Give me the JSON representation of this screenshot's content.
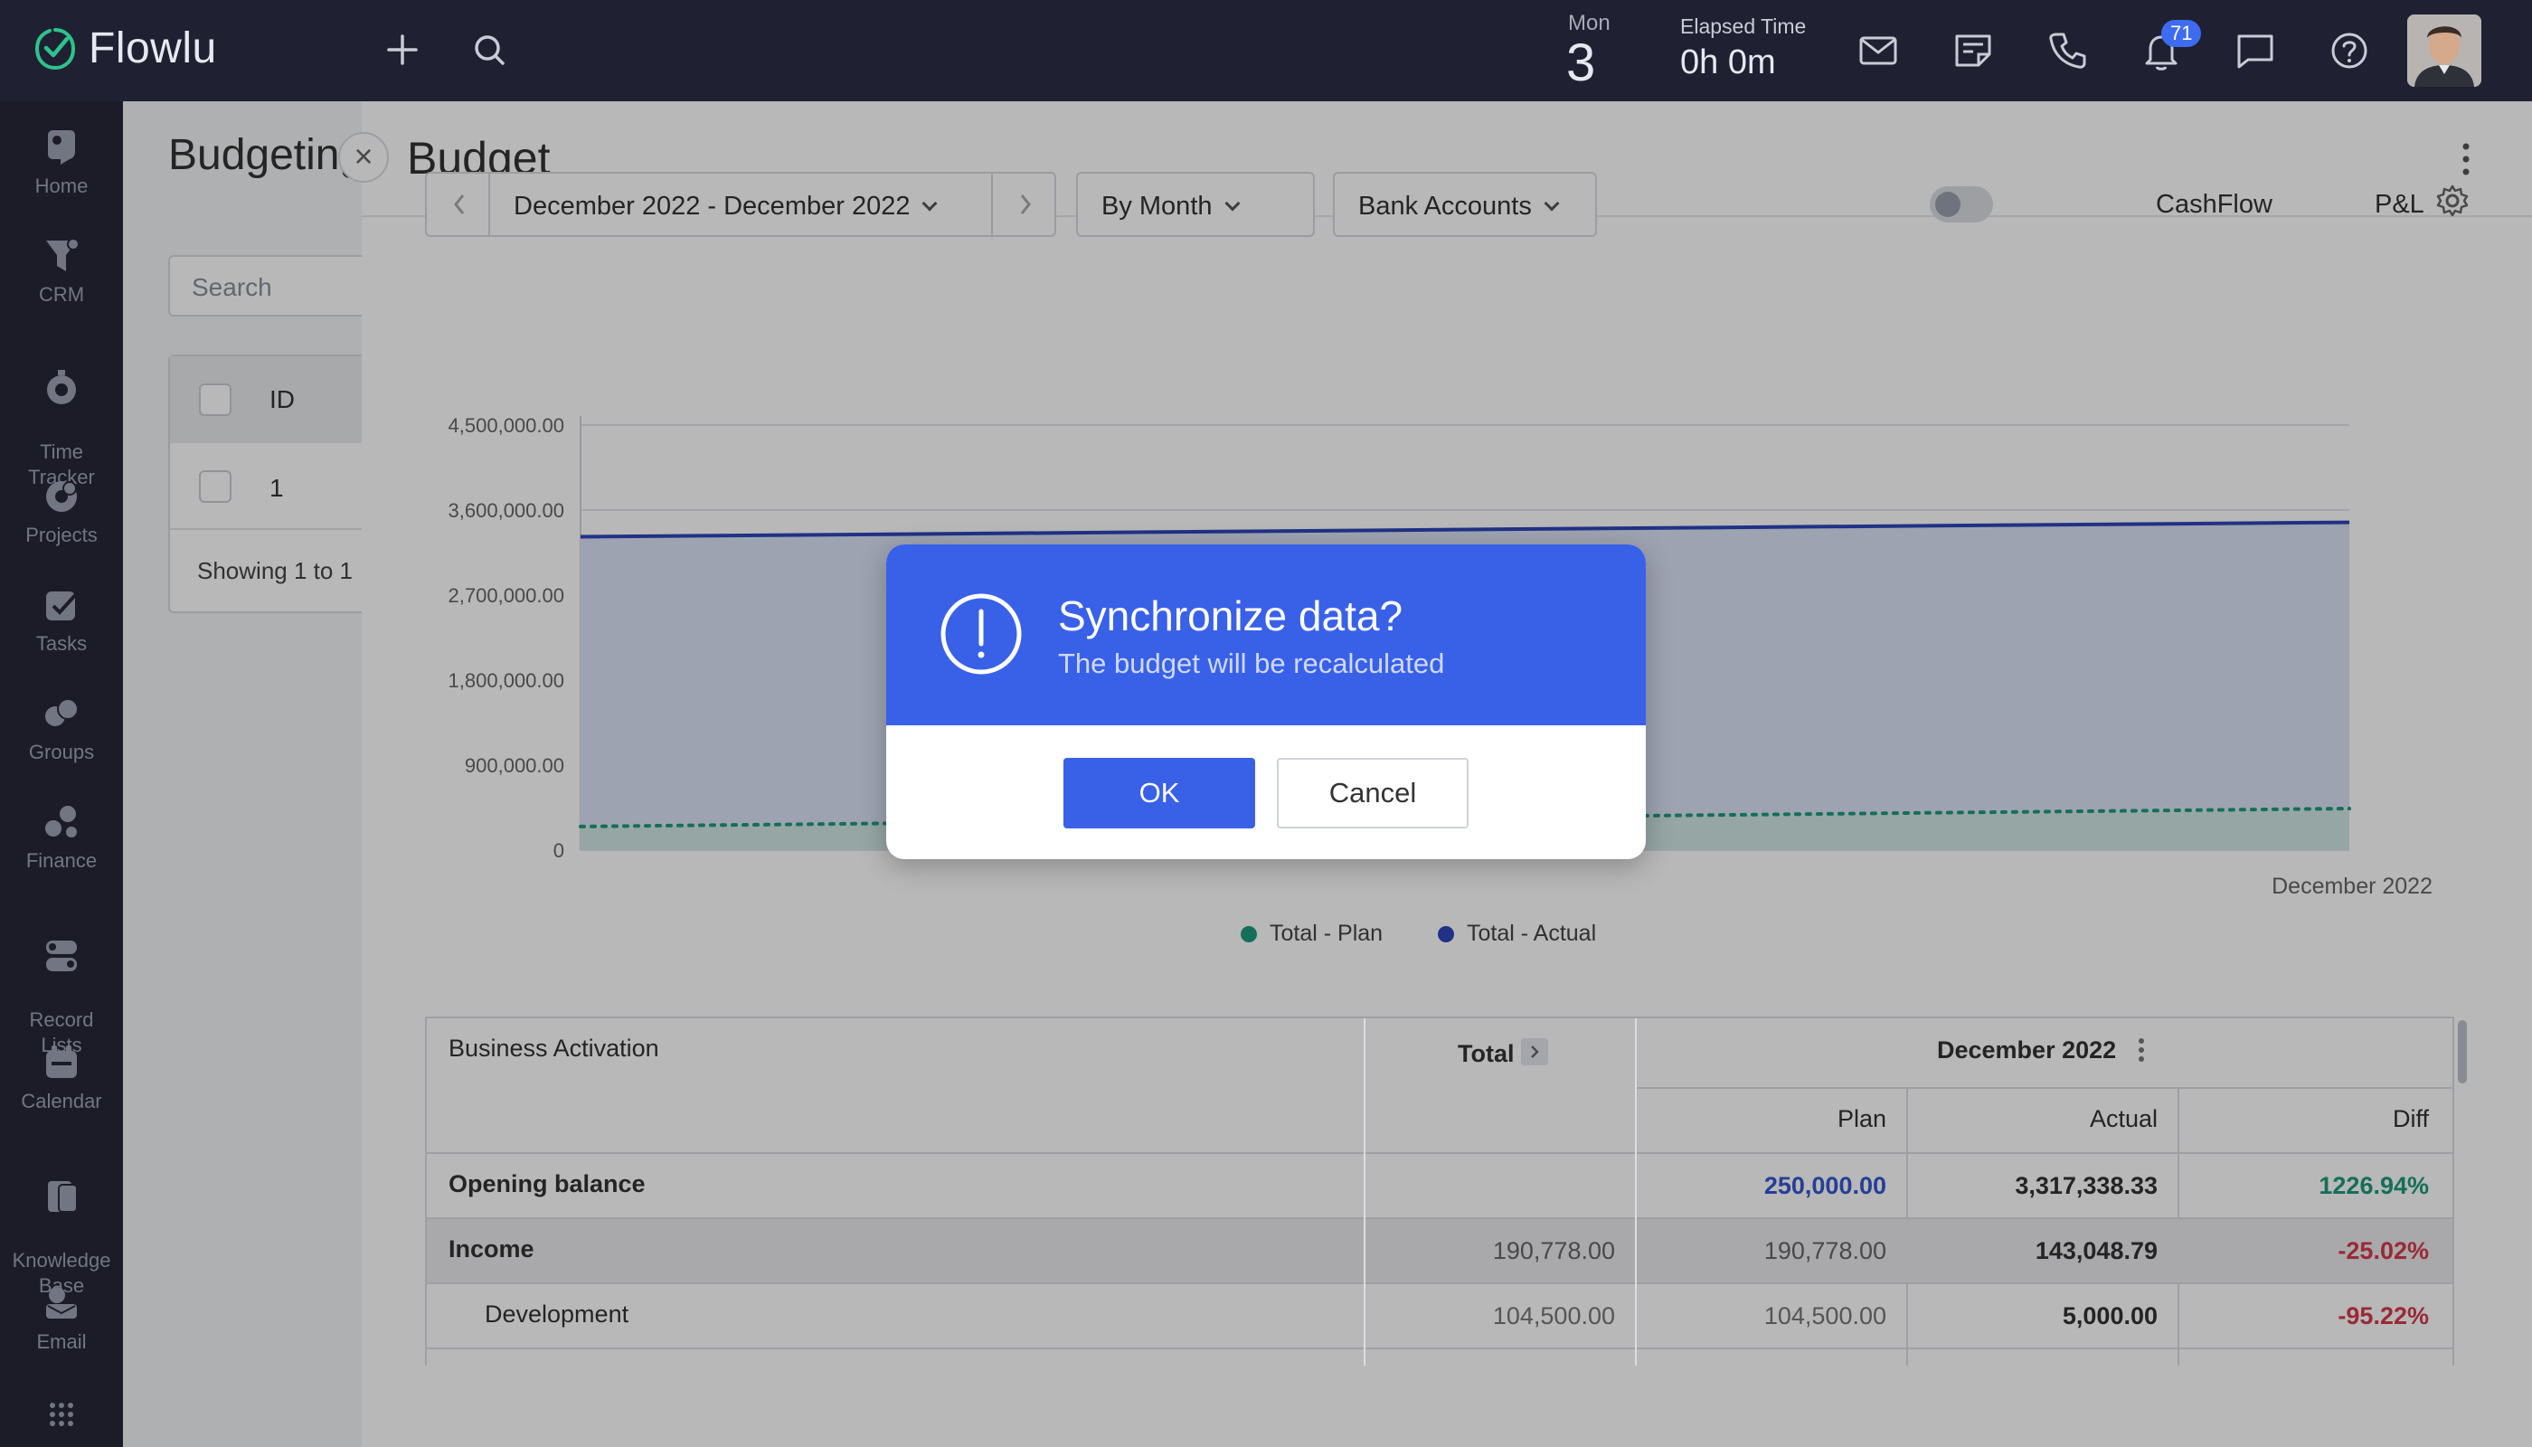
{
  "topbar": {
    "app_name": "Flowlu",
    "day_label": "Mon",
    "day_number": "3",
    "elapsed_label": "Elapsed Time",
    "elapsed_value": "0h 0m",
    "notification_count": "71",
    "icons": [
      "add-icon",
      "search-icon",
      "mail-icon",
      "notes-icon",
      "phone-icon",
      "bell-icon",
      "chat-icon",
      "help-icon"
    ]
  },
  "sidebar": {
    "items": [
      {
        "label": "Home",
        "icon": "home-icon"
      },
      {
        "label": "CRM",
        "icon": "crm-icon"
      },
      {
        "label": "Time\nTracker",
        "icon": "time-tracker-icon"
      },
      {
        "label": "Projects",
        "icon": "projects-icon"
      },
      {
        "label": "Tasks",
        "icon": "tasks-icon"
      },
      {
        "label": "Groups",
        "icon": "groups-icon"
      },
      {
        "label": "Finance",
        "icon": "finance-icon"
      },
      {
        "label": "Record\nLists",
        "icon": "record-lists-icon"
      },
      {
        "label": "Calendar",
        "icon": "calendar-icon"
      },
      {
        "label": "Knowledge\nBase",
        "icon": "knowledge-base-icon"
      },
      {
        "label": "Email",
        "icon": "email-icon"
      }
    ]
  },
  "background_page": {
    "title": "Budgeting",
    "search_placeholder": "Search",
    "column_id": "ID",
    "row_id": "1",
    "showing_text": "Showing 1 to 1"
  },
  "panel": {
    "title": "Budget",
    "date_range": "December 2022 - December 2022",
    "group_by": "By Month",
    "accounts": "Bank Accounts",
    "toggle_left": "CashFlow",
    "toggle_right": "P&L"
  },
  "chart_data": {
    "type": "area",
    "x": [
      "December 2022"
    ],
    "x_tick_label": "December 2022",
    "ylim": [
      0,
      4500000
    ],
    "y_ticks": [
      "4,500,000.00",
      "3,600,000.00",
      "2,700,000.00",
      "1,800,000.00",
      "900,000.00",
      "0"
    ],
    "series": [
      {
        "name": "Total - Actual",
        "color": "#2d46b9",
        "start": 3317338.33,
        "end": 3470000,
        "style": "solid"
      },
      {
        "name": "Total - Plan",
        "color": "#1e9a7a",
        "start": 250000,
        "end": 440000,
        "style": "dotted"
      }
    ],
    "grid": true,
    "legend_position": "bottom"
  },
  "budget_table": {
    "section_label": "Business Activation",
    "total_header": "Total",
    "month_header": "December 2022",
    "sub_headers": [
      "Plan",
      "Actual",
      "Diff"
    ],
    "rows": [
      {
        "label": "Opening balance",
        "total": "",
        "plan": "250,000.00",
        "actual": "3,317,338.33",
        "diff": "1226.94%"
      },
      {
        "label": "Income",
        "total": "190,778.00",
        "plan": "190,778.00",
        "actual": "143,048.79",
        "diff": "-25.02%"
      },
      {
        "label": "Development",
        "total": "104,500.00",
        "plan": "104,500.00",
        "actual": "5,000.00",
        "diff": "-95.22%"
      }
    ]
  },
  "modal": {
    "title": "Synchronize data?",
    "subtitle": "The budget will be recalculated",
    "ok_label": "OK",
    "cancel_label": "Cancel"
  }
}
